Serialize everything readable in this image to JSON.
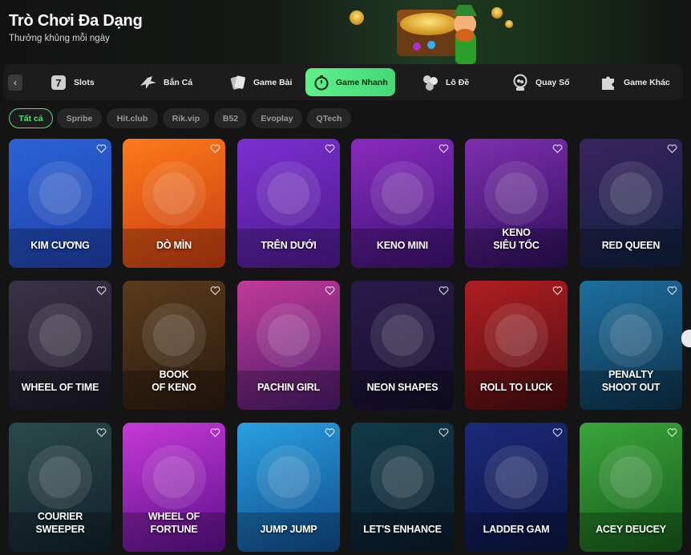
{
  "header": {
    "title": "Trò Chơi Đa Dạng",
    "subtitle": "Thưởng khủng mỗi ngày"
  },
  "categories": [
    {
      "label": "Slots",
      "icon": "seven-slot-icon"
    },
    {
      "label": "Bắn Cá",
      "icon": "shark-fishing-icon"
    },
    {
      "label": "Game Bài",
      "icon": "playing-cards-icon"
    },
    {
      "label": "Game Nhanh",
      "icon": "stopwatch-icon",
      "active": true
    },
    {
      "label": "Lô Đề",
      "icon": "lottery-balls-icon"
    },
    {
      "label": "Quay Số",
      "icon": "lottery-machine-icon"
    },
    {
      "label": "Game Khác",
      "icon": "puzzle-icon"
    }
  ],
  "providers": [
    "Tất cả",
    "Spribe",
    "Hit.club",
    "Rik.vip",
    "B52",
    "Evoplay",
    "QTech"
  ],
  "games": [
    {
      "name": "KIM CƯƠNG",
      "bg": [
        "#1f3ea8",
        "#2b63d6"
      ]
    },
    {
      "name": "DÒ MÌN",
      "bg": [
        "#c33a12",
        "#ff7a1a"
      ]
    },
    {
      "name": "TRÊN DƯỚI",
      "bg": [
        "#4b1a8c",
        "#7b2fd0"
      ]
    },
    {
      "name": "KENO MINI",
      "bg": [
        "#3b1170",
        "#8a2bbf"
      ]
    },
    {
      "name": "KENO\nSIÊU TỐC",
      "bg": [
        "#2c0e58",
        "#7f2fb0"
      ]
    },
    {
      "name": "RED QUEEN",
      "bg": [
        "#0f1f3c",
        "#3a2460"
      ]
    },
    {
      "name": "WHEEL OF TIME",
      "bg": [
        "#1a1826",
        "#3b3247"
      ]
    },
    {
      "name": "BOOK\nOF KENO",
      "bg": [
        "#2a1a0e",
        "#5a3b1c"
      ]
    },
    {
      "name": "PACHIN GIRL",
      "bg": [
        "#4a1a6a",
        "#c23a9a"
      ]
    },
    {
      "name": "NEON SHAPES",
      "bg": [
        "#130e2a",
        "#2a1a4a"
      ]
    },
    {
      "name": "ROLL TO LUCK",
      "bg": [
        "#4a0c10",
        "#b01e22"
      ]
    },
    {
      "name": "PENALTY\nSHOOT OUT",
      "bg": [
        "#0d3048",
        "#1d6fa0"
      ]
    },
    {
      "name": "COURIER\nSWEEPER",
      "bg": [
        "#10202a",
        "#2b4a4a"
      ]
    },
    {
      "name": "WHEEL OF\nFORTUNE",
      "bg": [
        "#5a0f8a",
        "#c63ad6"
      ]
    },
    {
      "name": "JUMP JUMP",
      "bg": [
        "#0f4a8a",
        "#2aa0e0"
      ]
    },
    {
      "name": "LET'S ENHANCE",
      "bg": [
        "#0a1a2a",
        "#123a4a"
      ]
    },
    {
      "name": "LADDER GAM",
      "bg": [
        "#0c1440",
        "#1b2a7a"
      ]
    },
    {
      "name": "ACEY DEUCEY",
      "bg": [
        "#165a1a",
        "#3aa53a"
      ]
    }
  ],
  "colors": {
    "accent": "#4fe07c",
    "background": "#141414"
  }
}
